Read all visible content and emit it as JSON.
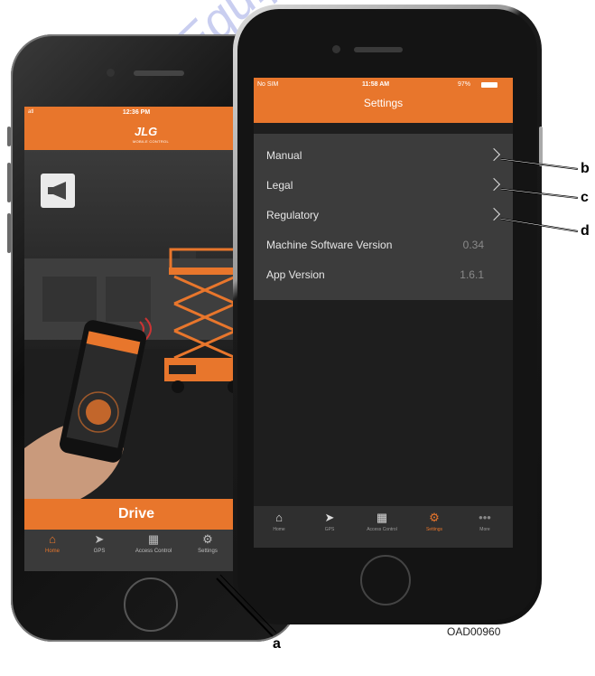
{
  "back_phone": {
    "status_time": "12:36 PM",
    "status_signal": "atl",
    "brand": "JLG",
    "brand_sub": "MOBILE CONTROL",
    "drive_label": "Drive",
    "tabs": [
      {
        "label": "Home",
        "icon": "home-icon",
        "active": true
      },
      {
        "label": "GPS",
        "icon": "navigation-icon",
        "active": false
      },
      {
        "label": "Access Control",
        "icon": "access-control-icon",
        "active": false
      },
      {
        "label": "Settings",
        "icon": "gear-icon",
        "active": false
      }
    ]
  },
  "front_phone": {
    "status": {
      "carrier": "No SIM",
      "time": "11:58 AM",
      "battery": "97%"
    },
    "title": "Settings",
    "rows": [
      {
        "label": "Manual",
        "value": "",
        "chevron": true
      },
      {
        "label": "Legal",
        "value": "",
        "chevron": true
      },
      {
        "label": "Regulatory",
        "value": "",
        "chevron": true
      },
      {
        "label": "Machine Software Version",
        "value": "0.34",
        "chevron": false
      },
      {
        "label": "App Version",
        "value": "1.6.1",
        "chevron": false
      }
    ],
    "tabs": [
      {
        "label": "Home",
        "icon": "home-icon",
        "active": false
      },
      {
        "label": "GPS",
        "icon": "navigation-icon",
        "active": false
      },
      {
        "label": "Access Control",
        "icon": "access-control-icon",
        "active": false
      },
      {
        "label": "Settings",
        "icon": "gear-icon",
        "active": true
      },
      {
        "label": "More",
        "icon": "more-icon",
        "active": false
      }
    ]
  },
  "callouts": {
    "a": "a",
    "b": "b",
    "c": "c",
    "d": "d"
  },
  "figure_code": "OAD00960",
  "watermark": "Discount-Equipment.com",
  "colors": {
    "accent": "#e8762c",
    "screen_bg": "#1e1e1e"
  }
}
